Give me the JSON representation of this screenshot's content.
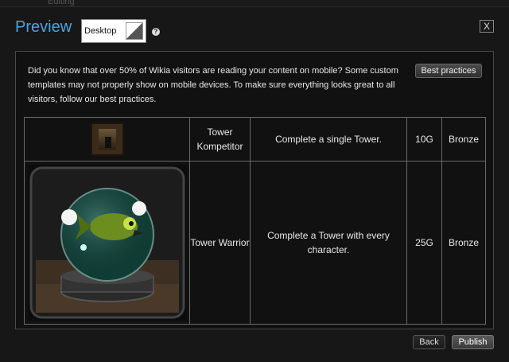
{
  "modal": {
    "title": "Preview",
    "view_select": {
      "value": "Desktop"
    },
    "help_label": "?",
    "close_label": "X"
  },
  "notice": {
    "text": "Did you know that over 50% of Wikia visitors are reading your content on mobile? Some custom templates may not properly show on mobile devices. To make sure everything looks great to all visitors, follow our best practices.",
    "button_label": "Best practices"
  },
  "table": {
    "rows": [
      {
        "name": "Tower Kompetitor",
        "description": "Complete a single Tower.",
        "points": "10G",
        "tier": "Bronze"
      },
      {
        "name": "Tower Warrior",
        "description": "Complete a Tower with every character.",
        "points": "25G",
        "tier": "Bronze"
      }
    ]
  },
  "footer": {
    "back_label": "Back",
    "publish_label": "Publish"
  },
  "colors": {
    "title": "#4aa3df",
    "modal_bg": "#171717",
    "accent_border": "#6a6a6a"
  }
}
